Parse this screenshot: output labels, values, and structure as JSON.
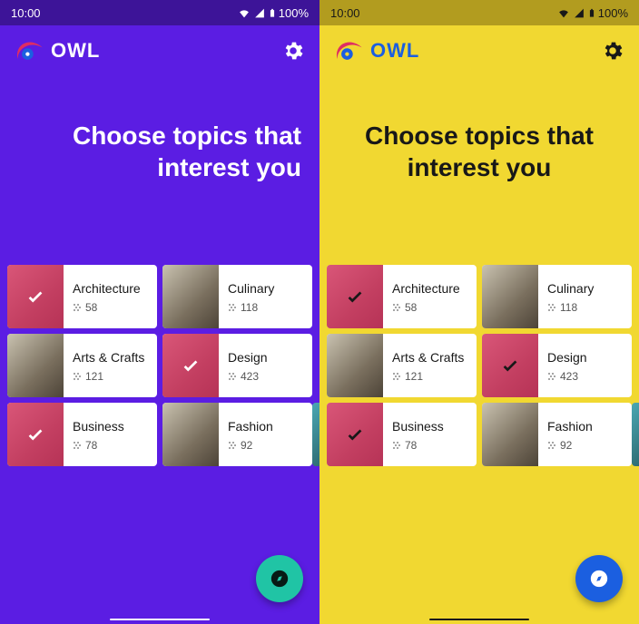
{
  "status": {
    "time": "10:00",
    "battery": "100%"
  },
  "brand": "OWL",
  "headline": "Choose topics that interest you",
  "topics": [
    {
      "name": "Architecture",
      "count": "58",
      "selected": true
    },
    {
      "name": "Culinary",
      "count": "118",
      "selected": false
    },
    {
      "name": "Arts & Crafts",
      "count": "121",
      "selected": false
    },
    {
      "name": "Design",
      "count": "423",
      "selected": true
    },
    {
      "name": "Business",
      "count": "78",
      "selected": true
    },
    {
      "name": "Fashion",
      "count": "92",
      "selected": false
    }
  ],
  "icons": {
    "settings": "gear-icon",
    "fab": "compass-icon"
  },
  "colors": {
    "purple_bg": "#5b1de3",
    "purple_status": "#3d1498",
    "yellow_bg": "#f1d831",
    "yellow_status": "#b29c1f",
    "accent_pink": "#df2d62",
    "fab_teal": "#20c4a5",
    "fab_blue": "#1b5fe0"
  }
}
